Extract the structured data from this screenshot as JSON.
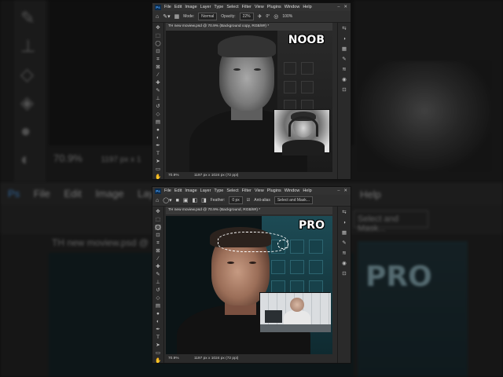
{
  "background": {
    "top": {
      "zoom_text": "70.9%",
      "dims_text": "1197 px x 1"
    },
    "bottom": {
      "menu": [
        "File",
        "Edit",
        "Image",
        "Laye"
      ],
      "help": "Help",
      "tab_text": "TH new moview.psd @",
      "select_mask": "Select and Mask...",
      "overlay_label": "PRO"
    }
  },
  "window_top": {
    "menu": [
      "File",
      "Edit",
      "Image",
      "Layer",
      "Type",
      "Select",
      "Filter",
      "View",
      "Plugins",
      "Window",
      "Help"
    ],
    "options": {
      "mode_label": "Mode:",
      "mode_value": "Normal",
      "opacity_label": "Opacity:",
      "opacity_value": "22%",
      "angle_value": "0°",
      "size_value": "100%"
    },
    "tab": "TH new moview.psd @ 70.9% (Background copy, RGB/8#) *",
    "overlay_label": "NOOB",
    "status": {
      "zoom": "70.9%",
      "dims": "1197 px x 1024 px (72 ppi)"
    }
  },
  "window_bottom": {
    "menu": [
      "File",
      "Edit",
      "Image",
      "Layer",
      "Type",
      "Select",
      "Filter",
      "View",
      "Plugins",
      "Window",
      "Help"
    ],
    "options": {
      "feather_label": "Feather:",
      "feather_value": "0 px",
      "antialias_label": "Anti-alias",
      "select_mask_label": "Select and Mask..."
    },
    "tab": "TH new moview.psd @ 70.9% (Background, RGB/8#) *",
    "overlay_label": "PRO",
    "status": {
      "zoom": "70.9%",
      "dims": "1197 px x 1024 px (72 ppi)"
    }
  },
  "colors": {
    "ui_dark": "#2b2b2b",
    "ps_blue": "#4aa3ff",
    "teal_wall": "#1d4b55"
  }
}
